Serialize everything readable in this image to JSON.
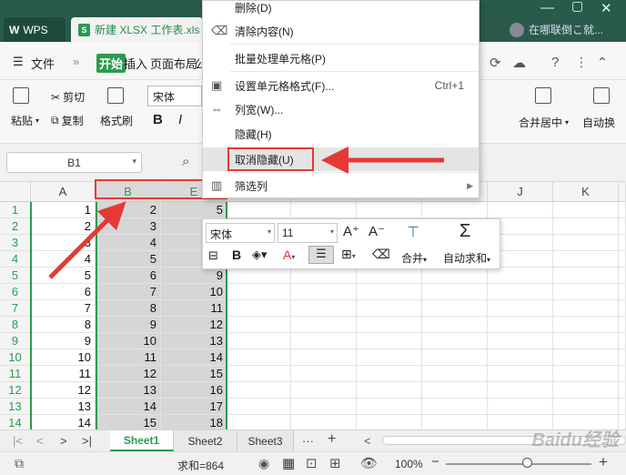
{
  "titlebar": {
    "wps_tab": "WPS",
    "doc_tab": "新建 XLSX 工作表.xls",
    "user_text": "在哪联倒こ就..."
  },
  "menubar": {
    "file": "文件",
    "more": "»",
    "start": "开始",
    "insert": "插入",
    "layout": "页面布局",
    "layout_cut": "公"
  },
  "ribbon": {
    "paste": "粘贴",
    "cut": "剪切",
    "copy": "复制",
    "format_painter": "格式刷",
    "font": "宋体",
    "bold": "B",
    "italic": "I",
    "merge_center": "合并居中",
    "auto_wrap": "自动换"
  },
  "formulabar": {
    "cell_ref": "B1"
  },
  "grid": {
    "columns": [
      "A",
      "B",
      "E",
      "F",
      "G",
      "H",
      "I",
      "J",
      "K"
    ],
    "rows": [
      {
        "n": "1",
        "a": "1",
        "b": "2",
        "e": "5"
      },
      {
        "n": "2",
        "a": "2",
        "b": "3",
        "e": "6"
      },
      {
        "n": "3",
        "a": "3",
        "b": "4",
        "e": "7"
      },
      {
        "n": "4",
        "a": "4",
        "b": "5",
        "e": "8"
      },
      {
        "n": "5",
        "a": "5",
        "b": "6",
        "e": "9"
      },
      {
        "n": "6",
        "a": "6",
        "b": "7",
        "e": "10"
      },
      {
        "n": "7",
        "a": "7",
        "b": "8",
        "e": "11"
      },
      {
        "n": "8",
        "a": "8",
        "b": "9",
        "e": "12"
      },
      {
        "n": "9",
        "a": "9",
        "b": "10",
        "e": "13"
      },
      {
        "n": "10",
        "a": "10",
        "b": "11",
        "e": "14"
      },
      {
        "n": "11",
        "a": "11",
        "b": "12",
        "e": "15"
      },
      {
        "n": "12",
        "a": "12",
        "b": "13",
        "e": "16"
      },
      {
        "n": "13",
        "a": "13",
        "b": "14",
        "e": "17"
      },
      {
        "n": "14",
        "a": "14",
        "b": "15",
        "e": "18"
      }
    ]
  },
  "context_menu": {
    "items": [
      {
        "label": "删除(D)",
        "shortcut": ""
      },
      {
        "label": "清除内容(N)",
        "shortcut": ""
      },
      {
        "label": "批量处理单元格(P)",
        "shortcut": ""
      },
      {
        "label": "设置单元格格式(F)...",
        "shortcut": "Ctrl+1"
      },
      {
        "label": "列宽(W)...",
        "shortcut": ""
      },
      {
        "label": "隐藏(H)",
        "shortcut": ""
      },
      {
        "label": "取消隐藏(U)",
        "shortcut": ""
      },
      {
        "label": "筛选列",
        "shortcut": ""
      }
    ]
  },
  "mini_toolbar": {
    "font": "宋体",
    "size": "11",
    "merge": "合并",
    "autosum": "自动求和",
    "bold": "B"
  },
  "sheets": {
    "tabs": [
      "Sheet1",
      "Sheet2",
      "Sheet3"
    ],
    "active": "Sheet1",
    "more": "···",
    "add": "+"
  },
  "statusbar": {
    "sum": "求和=864",
    "zoom": "100%",
    "minus": "−",
    "plus": "+"
  },
  "colors": {
    "accent": "#2d9b4e",
    "annotation": "#e53935"
  }
}
